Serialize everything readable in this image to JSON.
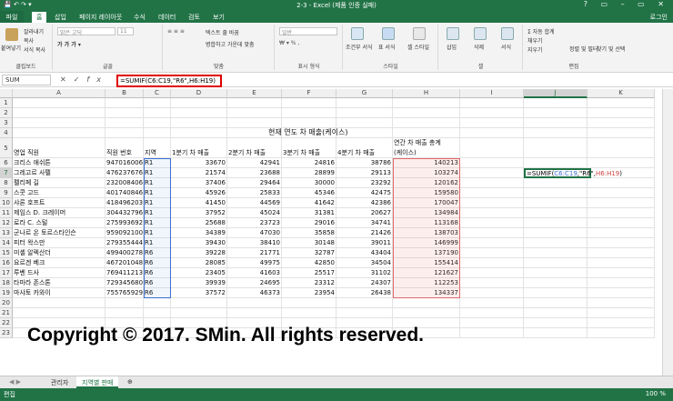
{
  "window": {
    "title": "2-3 - Excel (제품 인증 실패)",
    "quick_access": "💾 ↶ ↷ ▾",
    "controls": "? ▭ – ▭ ✕"
  },
  "ribbon_tabs": [
    "파일",
    "홈",
    "삽입",
    "페이지 레이아웃",
    "수식",
    "데이터",
    "검토",
    "보기"
  ],
  "login": "로그인",
  "ribbon": {
    "clipboard": {
      "paste": "붙여넣기",
      "cut": "잘라내기",
      "copy": "복사",
      "format": "서식 복사",
      "label": "클립보드"
    },
    "font": {
      "name": "맑은 고딕",
      "size": "11",
      "label": "글꼴"
    },
    "align": {
      "wrap": "텍스트 줄 바꿈",
      "merge": "병합하고 가운데 맞춤",
      "label": "맞춤"
    },
    "number": {
      "format": "일반",
      "label": "표시 형식"
    },
    "styles": {
      "cond": "조건부 서식",
      "table": "표 서식",
      "cell": "셀 스타일",
      "label": "스타일"
    },
    "cells": {
      "insert": "삽입",
      "delete": "삭제",
      "format": "서식",
      "label": "셀"
    },
    "editing": {
      "autosum": "자동 합계",
      "fill": "채우기",
      "clear": "지우기",
      "sort": "정렬 및 필터",
      "find": "찾기 및 선택",
      "label": "편집"
    }
  },
  "formula_bar": {
    "name_box": "SUM",
    "formula": "=SUMIF(C6:C19,\"R6\",H6:H19)"
  },
  "columns": [
    "A",
    "B",
    "C",
    "D",
    "E",
    "F",
    "G",
    "H",
    "I",
    "J",
    "K"
  ],
  "rows": [
    "1",
    "2",
    "3",
    "4",
    "5",
    "6",
    "7",
    "8",
    "9",
    "10",
    "11",
    "12",
    "13",
    "14",
    "15",
    "16",
    "17",
    "18",
    "19",
    "20",
    "21",
    "22",
    "23"
  ],
  "sheet": {
    "title": "현재 연도 차 매출(케이스)",
    "headers": [
      "영업 직원",
      "직원 번호",
      "지역",
      "1분기 차 매출",
      "2분기 차 매출",
      "3분기 차 매출",
      "4분기 차 매출",
      "연간 차 매출 총계",
      "(케이스)"
    ],
    "data": [
      [
        "크리스 애쉬튼",
        "947016006",
        "R1",
        "33670",
        "42941",
        "24816",
        "38786",
        "140213"
      ],
      [
        "그레고르 사펠",
        "476237676",
        "R1",
        "21574",
        "23688",
        "28899",
        "29113",
        "103274"
      ],
      [
        "펠리페 길",
        "232008406",
        "R1",
        "37406",
        "29464",
        "30000",
        "23292",
        "120162"
      ],
      [
        "스콧 고드",
        "401740846",
        "R1",
        "45926",
        "25833",
        "45346",
        "42475",
        "159580"
      ],
      [
        "샤론 호프트",
        "418496203",
        "R1",
        "41450",
        "44569",
        "41642",
        "42386",
        "170047"
      ],
      [
        "제임스 D. 크레이머",
        "304432796",
        "R1",
        "37952",
        "45024",
        "31381",
        "20627",
        "134984"
      ],
      [
        "로라 C. 스털",
        "275993692",
        "R1",
        "25688",
        "23723",
        "29016",
        "34741",
        "113168"
      ],
      [
        "군나르 온 토르스타인슨",
        "959092100",
        "R1",
        "34389",
        "47030",
        "35858",
        "21426",
        "138703"
      ],
      [
        "피터 왁스만",
        "279355444",
        "R1",
        "39430",
        "38410",
        "30148",
        "39011",
        "146999"
      ],
      [
        "미셸 알렉산더",
        "499400278",
        "R6",
        "39228",
        "21771",
        "32787",
        "43404",
        "137190"
      ],
      [
        "요르겐 베크",
        "467201048",
        "R6",
        "28085",
        "49975",
        "42850",
        "34504",
        "155414"
      ],
      [
        "루벤 드사",
        "769411213",
        "R6",
        "23405",
        "41603",
        "25517",
        "31102",
        "121627"
      ],
      [
        "타마라 존스톤",
        "729345680",
        "R6",
        "39939",
        "24695",
        "23312",
        "24307",
        "112253"
      ],
      [
        "마샤토 카와이",
        "755765929",
        "R6",
        "37572",
        "46373",
        "23954",
        "26438",
        "134337"
      ]
    ],
    "j7": "=SUMIF(C6:C19,\"R6\",H6:H19)",
    "j7_parts": {
      "a": "=SUMIF(",
      "b": "C6:C19",
      "c": ",\"R6\",",
      "d": "H6:H19",
      "e": ")"
    }
  },
  "watermark": "Copyright © 2017. SMin. All rights reserved.",
  "sheet_tabs": [
    "관리자",
    "지역별 판매"
  ],
  "status": {
    "mode": "편집",
    "zoom": "100 %"
  }
}
